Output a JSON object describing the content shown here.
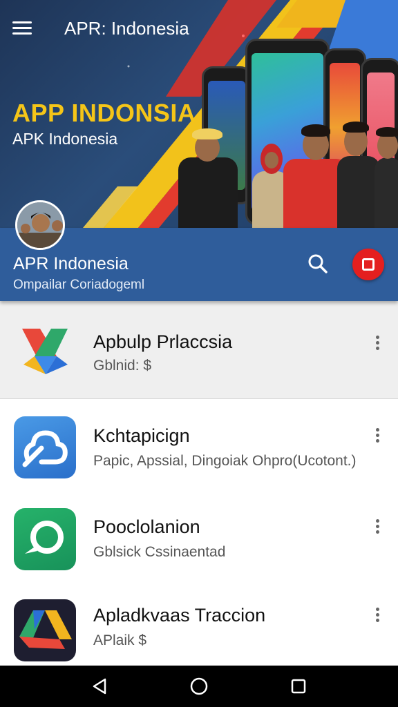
{
  "topbar": {
    "title": "APR: Indonesia",
    "menu_icon": "hamburger-menu-icon"
  },
  "hero": {
    "headline": "APP INDONSIA",
    "subheadline": "APK Indonesia",
    "headline_color": "#f5c518"
  },
  "header": {
    "title": "APR Indonesia",
    "subtitle": "Ompailar Coriadogeml",
    "search_icon": "search-icon",
    "stop_icon": "stop-square-icon",
    "band_color": "#2f5d9b",
    "stop_color": "#e41f1f"
  },
  "apps": [
    {
      "title": "Apbulp Prlaccsia",
      "subtitle": "Gblnid: $",
      "icon": "multicolor-x-triangle-icon"
    },
    {
      "title": "Kchtapicign",
      "subtitle": "Papic, Apssial, Dingoiak Ohpro(Ucotont.)",
      "icon": "cloud-swirl-icon"
    },
    {
      "title": "Pooclolanion",
      "subtitle": "Gblsick Cssinaentad",
      "icon": "chat-bubble-icon"
    },
    {
      "title": "Apladkvaas Traccion",
      "subtitle": "APlaik $",
      "icon": "drive-triangle-icon"
    }
  ],
  "navbar": {
    "back_icon": "back-triangle-icon",
    "home_icon": "home-circle-icon",
    "recents_icon": "recents-square-icon"
  }
}
